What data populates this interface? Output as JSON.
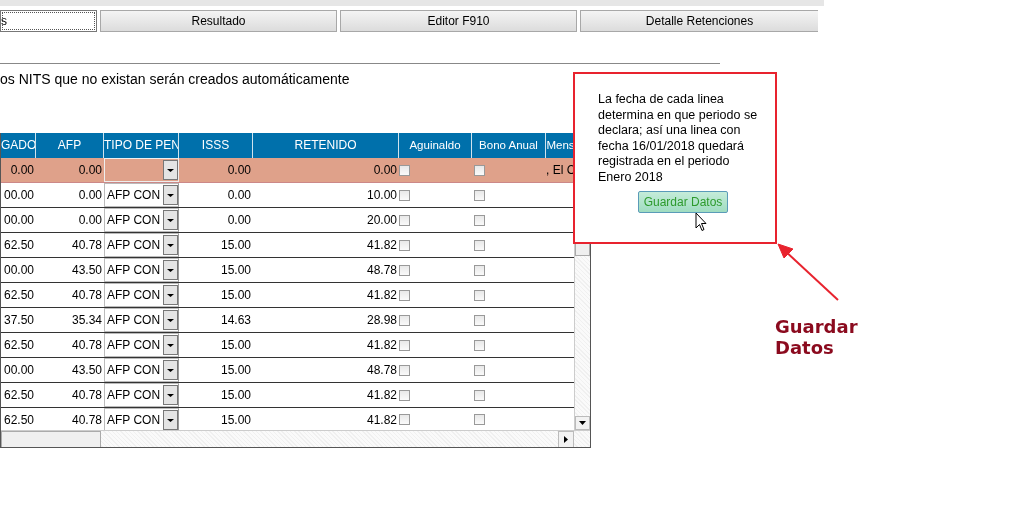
{
  "tabs": [
    {
      "label": "s",
      "selected": true
    },
    {
      "label": "Resultado",
      "selected": false
    },
    {
      "label": "Editor F910",
      "selected": false
    },
    {
      "label": "Detalle Retenciones",
      "selected": false
    }
  ],
  "notice": "os NITS que no existan serán creados automáticamente",
  "table": {
    "columns": [
      "GADO",
      "AFP",
      "TIPO DE PEN",
      "ISSS",
      "RETENIDO",
      "Aguinaldo",
      "Bono Anual",
      "Mens"
    ],
    "rows": [
      {
        "selected": true,
        "column_1": "0.00",
        "afp": "0.00",
        "tipo": "",
        "isss": "0.00",
        "retenido": "0.00",
        "aguinaldo": false,
        "bono_anual": false,
        "column_8": ", El C"
      },
      {
        "selected": false,
        "column_1": "00.00",
        "afp": "0.00",
        "tipo": "AFP CON",
        "isss": "0.00",
        "retenido": "10.00",
        "aguinaldo": false,
        "bono_anual": false
      },
      {
        "selected": false,
        "column_1": "00.00",
        "afp": "0.00",
        "tipo": "AFP CON",
        "isss": "0.00",
        "retenido": "20.00",
        "aguinaldo": false,
        "bono_anual": false
      },
      {
        "selected": false,
        "column_1": "62.50",
        "afp": "40.78",
        "tipo": "AFP CON",
        "isss": "15.00",
        "retenido": "41.82",
        "aguinaldo": false,
        "bono_anual": false
      },
      {
        "selected": false,
        "column_1": "00.00",
        "afp": "43.50",
        "tipo": "AFP CON",
        "isss": "15.00",
        "retenido": "48.78",
        "aguinaldo": false,
        "bono_anual": false
      },
      {
        "selected": false,
        "column_1": "62.50",
        "afp": "40.78",
        "tipo": "AFP CON",
        "isss": "15.00",
        "retenido": "41.82",
        "aguinaldo": false,
        "bono_anual": false
      },
      {
        "selected": false,
        "column_1": "37.50",
        "afp": "35.34",
        "tipo": "AFP CON",
        "isss": "14.63",
        "retenido": "28.98",
        "aguinaldo": false,
        "bono_anual": false
      },
      {
        "selected": false,
        "column_1": "62.50",
        "afp": "40.78",
        "tipo": "AFP CON",
        "isss": "15.00",
        "retenido": "41.82",
        "aguinaldo": false,
        "bono_anual": false
      },
      {
        "selected": false,
        "column_1": "00.00",
        "afp": "43.50",
        "tipo": "AFP CON",
        "isss": "15.00",
        "retenido": "48.78",
        "aguinaldo": false,
        "bono_anual": false
      },
      {
        "selected": false,
        "column_1": "62.50",
        "afp": "40.78",
        "tipo": "AFP CON",
        "isss": "15.00",
        "retenido": "41.82",
        "aguinaldo": false,
        "bono_anual": false
      },
      {
        "selected": false,
        "column_1": "62.50",
        "afp": "40.78",
        "tipo": "AFP CON",
        "isss": "15.00",
        "retenido": "41.82",
        "aguinaldo": false,
        "bono_anual": false
      }
    ]
  },
  "callout": {
    "text": "La fecha de cada linea determina en que periodo se declara; así una linea con fecha 16/01/2018 quedará registrada en el periodo Enero 2018",
    "button": "Guardar Datos"
  },
  "annotation": "Guardar Datos"
}
